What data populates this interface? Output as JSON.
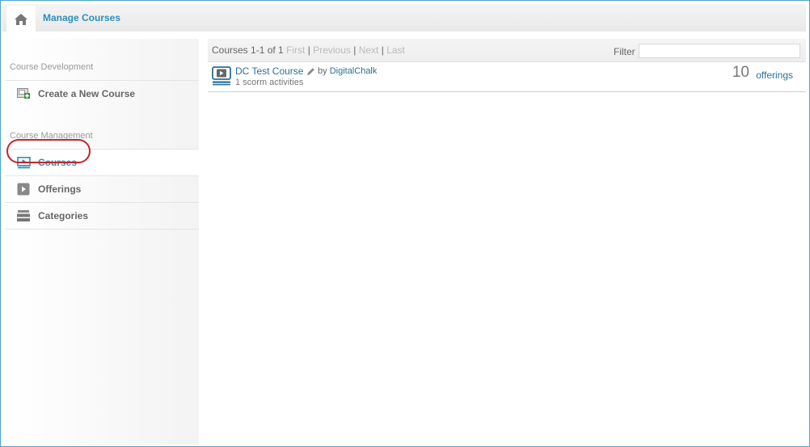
{
  "header": {
    "home_icon": "home-icon",
    "title": "Manage Courses"
  },
  "sidebar": {
    "section_development": "Course Development",
    "create_course": {
      "label": "Create a New Course",
      "icon": "add-course-icon"
    },
    "section_management": "Course Management",
    "items": [
      {
        "label": "Courses",
        "icon": "play-screen-icon",
        "active": true
      },
      {
        "label": "Offerings",
        "icon": "play-box-icon",
        "active": false
      },
      {
        "label": "Categories",
        "icon": "stack-icon",
        "active": false
      }
    ]
  },
  "pager": {
    "range": "Courses 1-1 of 1",
    "first": "First",
    "previous": "Previous",
    "next": "Next",
    "last": "Last",
    "separator": "|",
    "filter_label": "Filter",
    "filter_value": ""
  },
  "courses": [
    {
      "name": "DC Test Course",
      "by": "by",
      "author": "DigitalChalk",
      "activities": "1 scorm activities",
      "offerings_count": "10",
      "offerings_label": "offerings"
    }
  ],
  "colors": {
    "accent": "#2b8fbd",
    "link": "#2a6f99",
    "highlight": "#c0282d",
    "frame_border": "#4fa3c9"
  }
}
